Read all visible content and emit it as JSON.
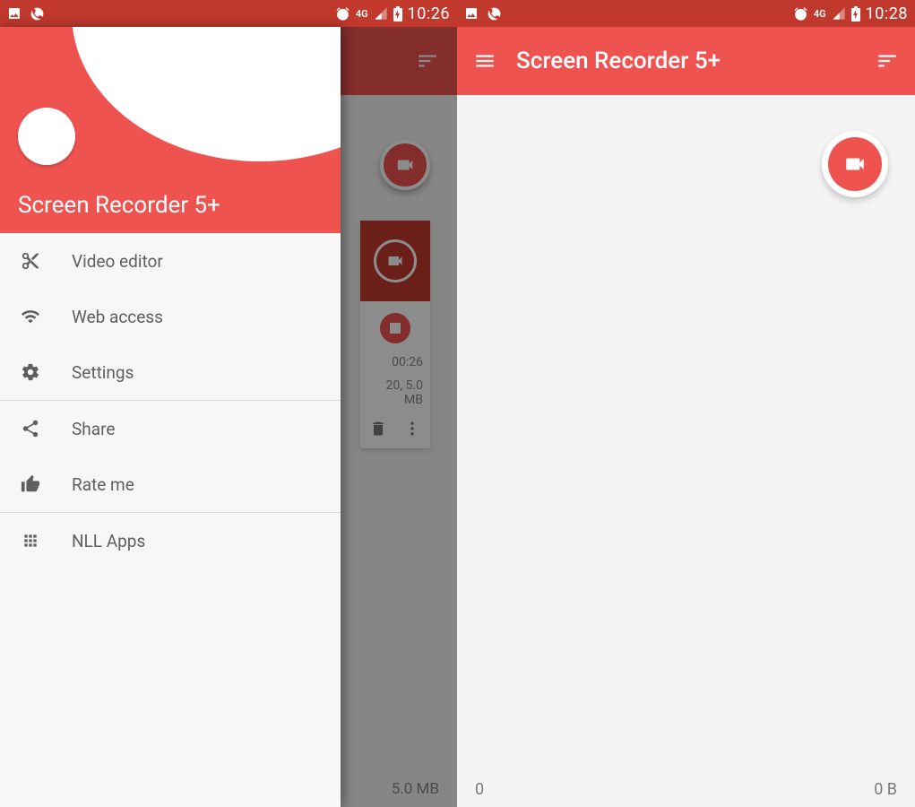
{
  "colors": {
    "primary": "#ef5350",
    "primaryDark": "#c1392d",
    "grey": "#5f5f5f"
  },
  "status_left": {
    "time": "10:26",
    "network": "4G"
  },
  "status_right": {
    "time": "10:28",
    "network": "4G"
  },
  "app_title": "Screen Recorder 5+",
  "drawer": {
    "title": "Screen Recorder 5+",
    "items": [
      {
        "icon": "scissors",
        "label": "Video editor"
      },
      {
        "icon": "wifi",
        "label": "Web access"
      },
      {
        "icon": "gear",
        "label": "Settings"
      },
      {
        "icon": "share",
        "label": "Share"
      },
      {
        "icon": "thumbs",
        "label": "Rate me"
      },
      {
        "icon": "apps",
        "label": "NLL Apps"
      }
    ]
  },
  "left_bg": {
    "duration": "00:26",
    "meta": "20, 5.0 MB",
    "total": "5.0 MB"
  },
  "right_bottom": {
    "count": "0",
    "size": "0 B"
  }
}
